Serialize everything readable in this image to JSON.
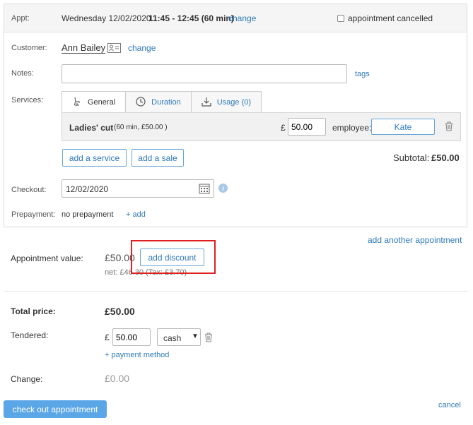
{
  "appt": {
    "label": "Appt:",
    "date": "Wednesday 12/02/2020",
    "time": "11:45 - 12:45 (60 min)",
    "change_link": "change",
    "cancelled_label": "appointment cancelled"
  },
  "customer": {
    "label": "Customer:",
    "name": "Ann Bailey",
    "change_link": "change"
  },
  "notes": {
    "label": "Notes:",
    "value": "",
    "tags_link": "tags"
  },
  "services": {
    "label": "Services:",
    "tabs": [
      {
        "label": "General",
        "icon": "chair-icon"
      },
      {
        "label": "Duration",
        "icon": "clock-icon"
      },
      {
        "label": "Usage (0)",
        "icon": "download-icon"
      }
    ],
    "item": {
      "name": "Ladies' cut",
      "detail": "(60 min, £50.00 )",
      "currency": "£",
      "price": "50.00",
      "employee_label": "employee:",
      "employee": "Kate"
    },
    "add_service": "add a service",
    "add_sale": "add a sale",
    "subtotal_label": "Subtotal:",
    "subtotal_value": "£50.00"
  },
  "checkout": {
    "label": "Checkout:",
    "date": "12/02/2020",
    "info_icon": "i"
  },
  "prepayment": {
    "label": "Prepayment:",
    "value": "no prepayment",
    "add_link": "+ add"
  },
  "add_another": "add another appointment",
  "appointment_value": {
    "label": "Appointment value:",
    "value": "£50.00",
    "add_discount": "add discount",
    "net": "net: £46.30 (Tax: £3.70)"
  },
  "total": {
    "label": "Total price:",
    "value": "£50.00"
  },
  "tendered": {
    "label": "Tendered:",
    "currency": "£",
    "amount": "50.00",
    "method": "cash",
    "add_method": "+ payment method"
  },
  "change": {
    "label": "Change:",
    "value": "£0.00"
  },
  "actions": {
    "checkout": "check out appointment",
    "cancel": "cancel"
  },
  "colors": {
    "accent": "#2f7ab9",
    "primary_button": "#5aa6e6",
    "highlight": "#e02020"
  }
}
